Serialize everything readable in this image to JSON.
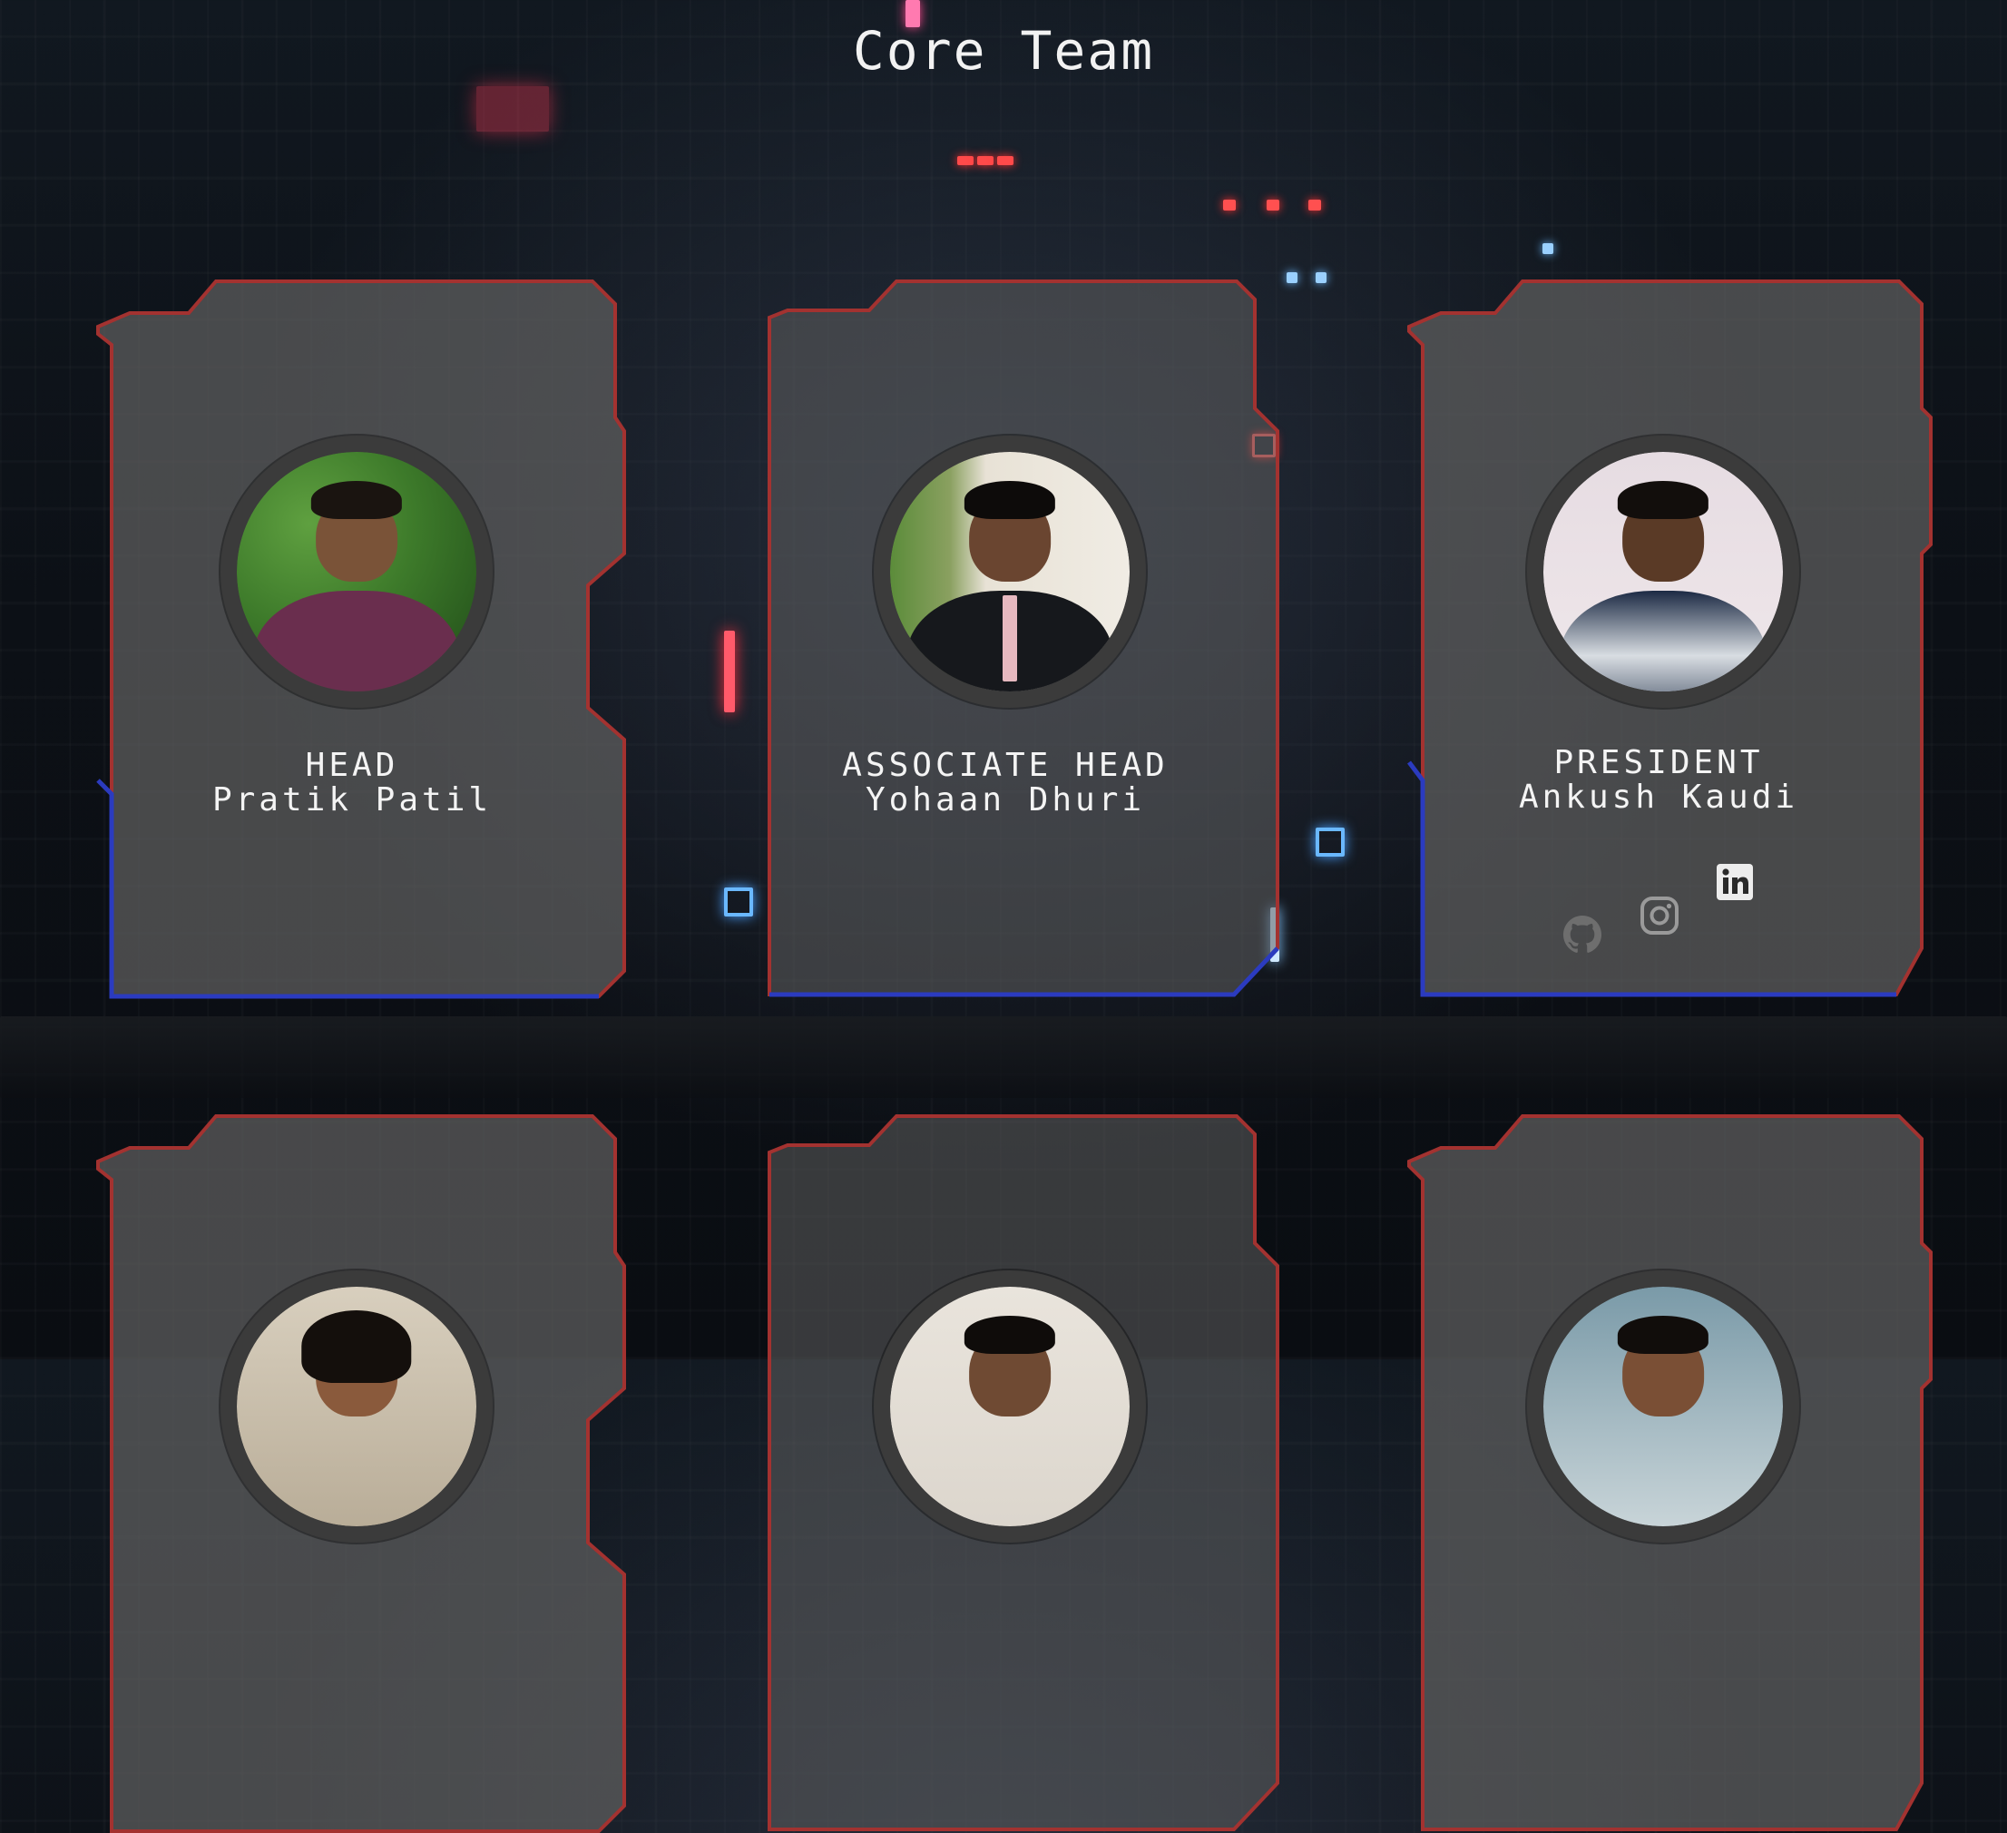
{
  "page": {
    "title": "Core Team"
  },
  "members": [
    {
      "role": "HEAD",
      "name": "Pratik Patil"
    },
    {
      "role": "ASSOCIATE HEAD",
      "name": "Yohaan Dhuri"
    },
    {
      "role": "PRESIDENT",
      "name": "Ankush Kaudi"
    }
  ],
  "social": {
    "icons": [
      "linkedin-icon",
      "instagram-icon",
      "github-icon"
    ]
  },
  "colors": {
    "card_fill": "#5a5a5a",
    "card_border_top": "#b3312f",
    "card_border_bottom": "#2b3bbf",
    "avatar_ring": "#3b3b3b"
  }
}
